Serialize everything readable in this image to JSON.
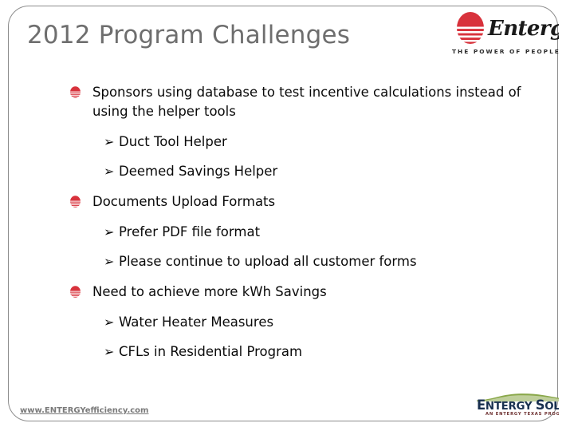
{
  "slide": {
    "title": "2012 Program Challenges",
    "title_color": "#6e6e6e",
    "background": "#ffffff",
    "border_color": "#8c8c8c"
  },
  "brand": {
    "accent_red": "#d8323c",
    "solutions_navy": "#18304f",
    "solutions_green": "#8aa84a",
    "entergy": {
      "wordmark": "Entergy.",
      "tagline": "THE POWER OF PEOPLE",
      "sun_icon": "entergy-sun-icon"
    },
    "entergy_solutions": {
      "wordmark_part1": "E",
      "wordmark_part1_rest": "NTERGY",
      "wordmark_part2": "S",
      "wordmark_part2_rest": "OLUTIONS",
      "wordmark_full": "ENTERGY SOLUTIONS",
      "tagline": "AN ENTERGY TEXAS PROGRAM"
    }
  },
  "bullet_icons": {
    "level1": "red-sun-bullet-icon",
    "level2": "arrow-bullet-icon",
    "level2_glyph": "➢"
  },
  "content": {
    "groups": [
      {
        "heading": "Sponsors using database to test incentive calculations instead of using the helper tools",
        "items": [
          "Duct Tool Helper",
          "Deemed Savings Helper"
        ]
      },
      {
        "heading": "Documents Upload Formats",
        "items": [
          "Prefer PDF file format",
          "Please continue to upload all customer forms"
        ]
      },
      {
        "heading": "Need to achieve more kWh Savings",
        "items": [
          "Water Heater Measures",
          "CFLs in Residential Program"
        ]
      }
    ]
  },
  "footer": {
    "url": "www.ENTERGYefficiency.com"
  }
}
